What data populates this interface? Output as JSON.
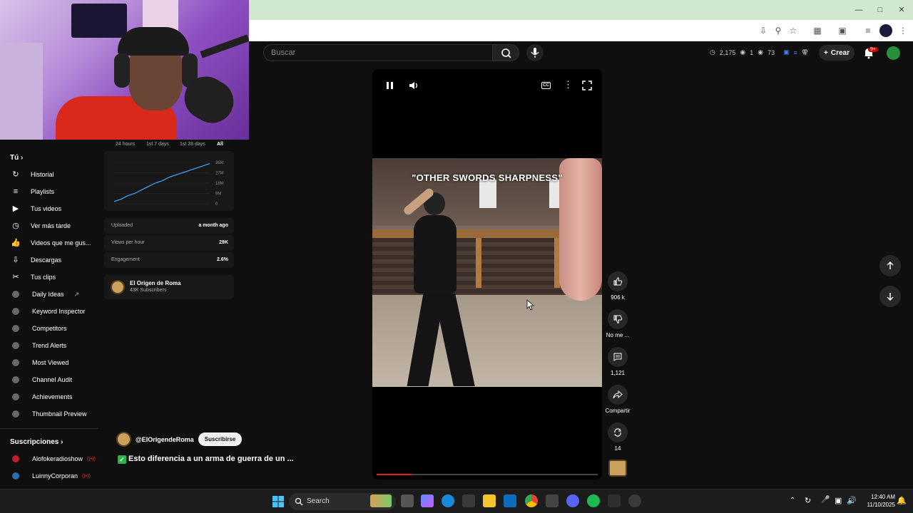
{
  "browser": {
    "window_controls": [
      "minimize",
      "maximize",
      "close"
    ]
  },
  "youtube_header": {
    "search_placeholder": "Buscar",
    "stats": {
      "views": "2,175",
      "likes": "1",
      "watching": "73"
    },
    "create_label": "Crear",
    "notifications_badge": "9+"
  },
  "sidebar": {
    "you_heading": "Tú",
    "you_items": [
      {
        "label": "Historial",
        "icon": "history-icon"
      },
      {
        "label": "Playlists",
        "icon": "playlist-icon"
      },
      {
        "label": "Tus videos",
        "icon": "video-icon"
      },
      {
        "label": "Ver más tarde",
        "icon": "clock-icon"
      },
      {
        "label": "Videos que me gus...",
        "icon": "thumbs-up-icon"
      },
      {
        "label": "Descargas",
        "icon": "download-icon"
      },
      {
        "label": "Tus clips",
        "icon": "scissors-icon"
      }
    ],
    "tool_items": [
      {
        "label": "Daily Ideas"
      },
      {
        "label": "Keyword Inspector"
      },
      {
        "label": "Competitors"
      },
      {
        "label": "Trend Alerts"
      },
      {
        "label": "Most Viewed"
      },
      {
        "label": "Channel Audit"
      },
      {
        "label": "Achievements"
      },
      {
        "label": "Thumbnail Preview"
      }
    ],
    "subs_heading": "Suscripciones",
    "subscriptions": [
      {
        "label": "Alofokeradioshow"
      },
      {
        "label": "LuinnyCorporan"
      }
    ]
  },
  "analytics": {
    "ranges": [
      "24 hours",
      "1st 7 days",
      "1st 28 days",
      "All"
    ],
    "active_range": "All",
    "rows": [
      {
        "label": "Uploaded",
        "value": "a month ago"
      },
      {
        "label": "Views per hour",
        "value": "29K"
      },
      {
        "label": "Engagement",
        "value": "2.6%"
      }
    ],
    "channel_name": "El Origen de Roma",
    "channel_subs": "43K Subscribers"
  },
  "chart_data": {
    "type": "line",
    "title": "",
    "xlabel": "",
    "ylabel": "",
    "y_ticks": [
      "36M",
      "27M",
      "18M",
      "9M",
      "0"
    ],
    "ylim": [
      0,
      36
    ],
    "series": [
      {
        "values": [
          2,
          4,
          7,
          9,
          12,
          15,
          18,
          20,
          23,
          25,
          27,
          29,
          31,
          33,
          35
        ]
      }
    ],
    "line_color": "#3ea6ff",
    "grid": true
  },
  "player": {
    "caption": "\"OTHER SWORDS SHARPNESS\"",
    "progress": 0.16
  },
  "actions": {
    "likes": "906 k",
    "dislike": "No me ...",
    "comments": "1,121",
    "share": "Compartir",
    "remix": "14"
  },
  "video_meta": {
    "channel_handle": "@ElOrigendeRoma",
    "subscribe_label": "Suscribirse",
    "title": "Esto diferencia a un arma de guerra de un ..."
  },
  "taskbar": {
    "search_label": "Search",
    "time": "12:40 AM",
    "date": "11/10/2025"
  }
}
